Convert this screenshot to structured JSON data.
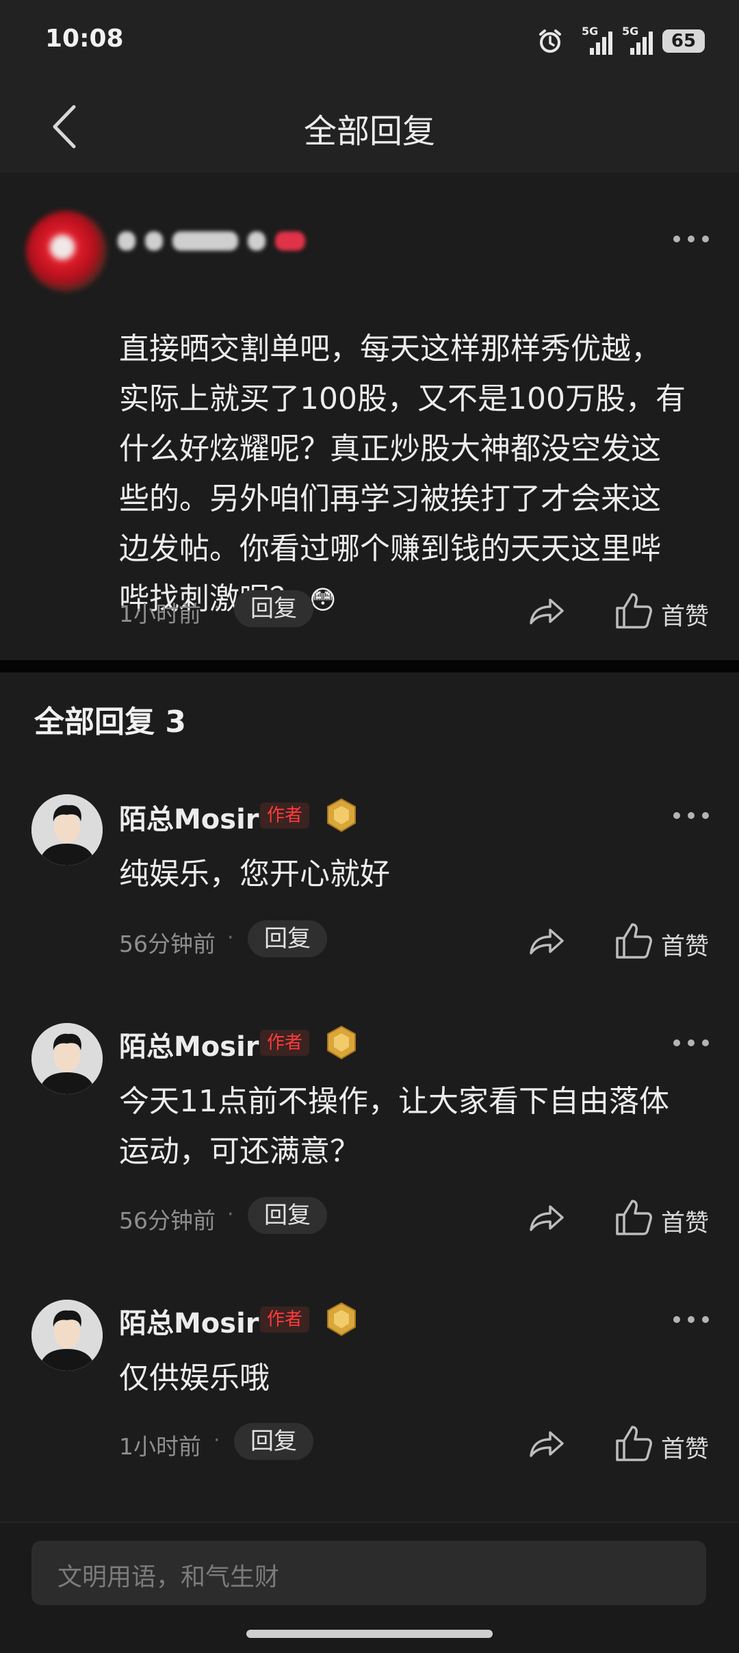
{
  "status_bar": {
    "time": "10:08",
    "signal1": "5G",
    "signal2": "5G",
    "battery": "65"
  },
  "nav": {
    "title": "全部回复",
    "back_icon": "chevron-left-icon"
  },
  "original_comment": {
    "username": "",
    "text": "直接晒交割单吧，每天这样那样秀优越，\n实际上就买了100股，又不是100万股，有\n什么好炫耀呢？真正炒股大神都没空发这\n些的。另外咱们再学习被挨打了才会来这\n边发帖。你看过哪个赚到钱的天天这里哔\n哔找刺激呢？",
    "emoji": "😳",
    "time": "1小时前",
    "reply_label": "回复",
    "like_label": "首赞"
  },
  "replies_section": {
    "title": "全部回复 3"
  },
  "replies": [
    {
      "username": "陌总Mosir",
      "badge": "作者",
      "text": "纯娱乐，您开心就好",
      "time": "56分钟前",
      "reply_label": "回复",
      "like_label": "首赞"
    },
    {
      "username": "陌总Mosir",
      "badge": "作者",
      "text": "今天11点前不操作，让大家看下自由落体\n运动，可还满意？",
      "time": "56分钟前",
      "reply_label": "回复",
      "like_label": "首赞"
    },
    {
      "username": "陌总Mosir",
      "badge": "作者",
      "text": "仅供娱乐哦",
      "time": "1小时前",
      "reply_label": "回复",
      "like_label": "首赞"
    }
  ],
  "input": {
    "placeholder": "文明用语，和气生财"
  },
  "colors": {
    "background": "#1c1c1c",
    "author_badge": "#ff3b3b",
    "medal": "#d9a63a"
  }
}
